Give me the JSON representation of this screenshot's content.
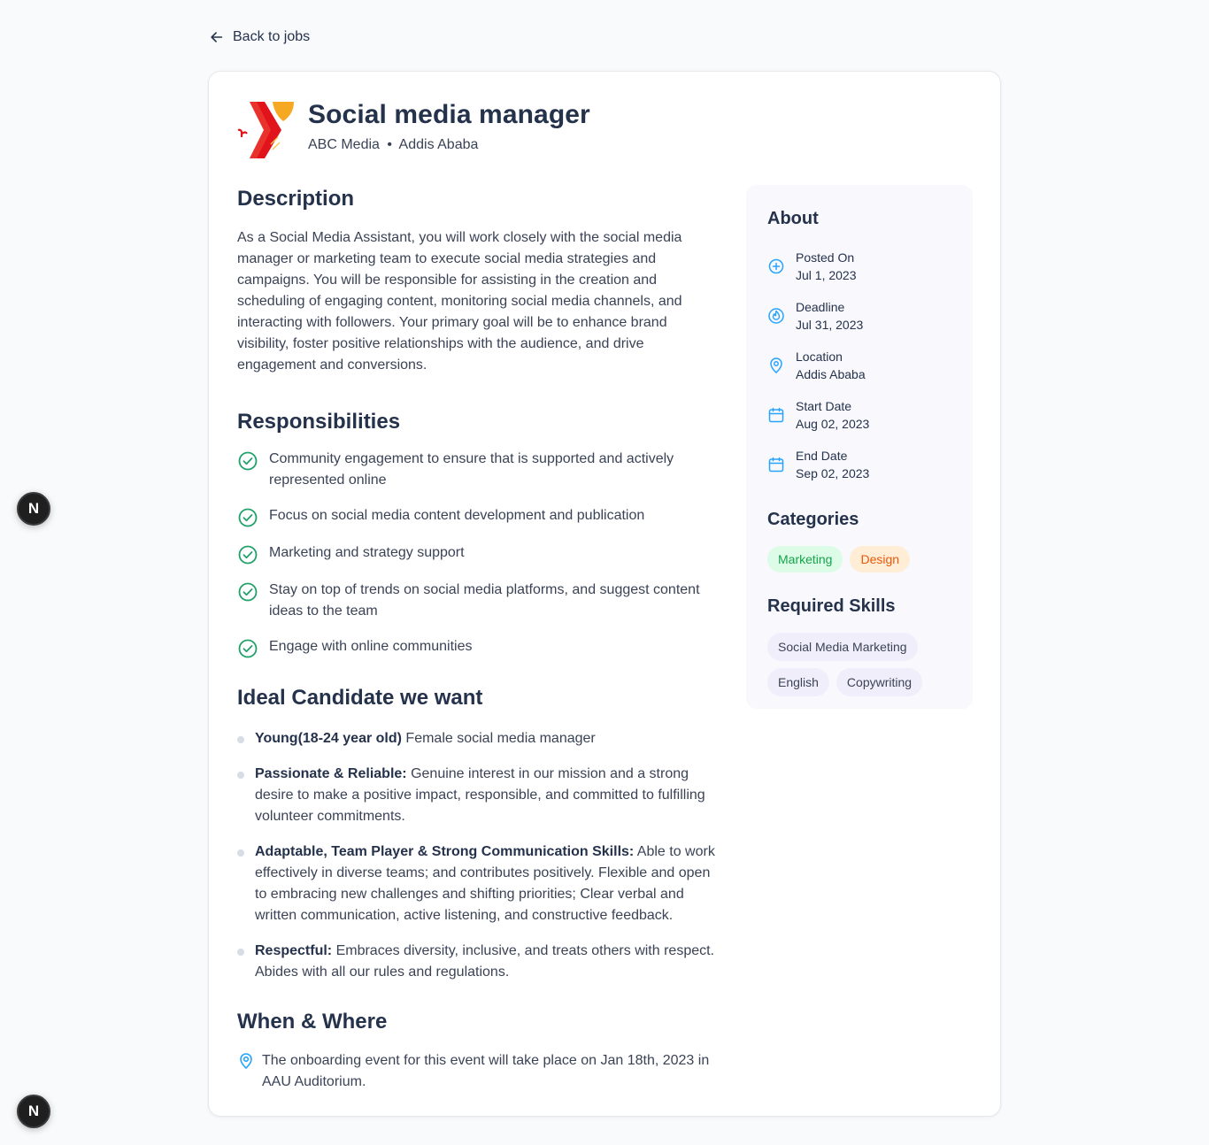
{
  "nav": {
    "back_label": "Back to jobs"
  },
  "job": {
    "title": "Social media manager",
    "company": "ABC Media",
    "separator": "•",
    "location": "Addis Ababa"
  },
  "description": {
    "heading": "Description",
    "text": "As a Social Media Assistant, you will work closely with the social media manager or marketing team to execute social media strategies and campaigns. You will be responsible for assisting in the creation and scheduling of engaging content, monitoring social media channels, and interacting with followers. Your primary goal will be to enhance brand visibility, foster positive relationships with the audience, and drive engagement and conversions."
  },
  "responsibilities": {
    "heading": "Responsibilities",
    "items": [
      "Community engagement to ensure that is supported and actively represented online",
      "Focus on social media content development and publication",
      "Marketing and strategy support",
      "Stay on top of trends on social media platforms, and suggest content ideas to the team",
      "Engage with online communities"
    ]
  },
  "ideal": {
    "heading": "Ideal Candidate we want",
    "items": [
      {
        "bold": "Young(18-24 year old)",
        "text": " Female social media manager"
      },
      {
        "bold": "Passionate & Reliable:",
        "text": " Genuine interest in our mission and a strong desire to make a positive impact, responsible, and committed to fulfilling volunteer commitments."
      },
      {
        "bold": "Adaptable, Team Player & Strong Communication Skills:",
        "text": " Able to work effectively in diverse teams; and contributes positively. Flexible and open to embracing new challenges and shifting priorities; Clear verbal and written communication, active listening, and constructive feedback."
      },
      {
        "bold": "Respectful:",
        "text": " Embraces diversity, inclusive, and treats others with respect. Abides with all our rules and regulations."
      }
    ]
  },
  "when_where": {
    "heading": "When & Where",
    "text": "The onboarding event for this event will take place on Jan 18th, 2023 in AAU Auditorium."
  },
  "about": {
    "heading": "About",
    "items": [
      {
        "label": "Posted On",
        "value": "Jul 1, 2023",
        "icon": "plus-circle-icon"
      },
      {
        "label": "Deadline",
        "value": "Jul 31, 2023",
        "icon": "fire-icon"
      },
      {
        "label": "Location",
        "value": "Addis Ababa",
        "icon": "location-pin-icon"
      },
      {
        "label": "Start Date",
        "value": "Aug 02, 2023",
        "icon": "calendar-icon"
      },
      {
        "label": "End Date",
        "value": "Sep 02, 2023",
        "icon": "calendar-icon"
      }
    ]
  },
  "categories": {
    "heading": "Categories",
    "items": [
      "Marketing",
      "Design"
    ]
  },
  "skills": {
    "heading": "Required Skills",
    "items": [
      "Social Media Marketing",
      "English",
      "Copywriting"
    ]
  },
  "fab": {
    "label": "N"
  },
  "colors": {
    "accent_blue": "#26a4ff",
    "check_green": "#56cdad",
    "text_dark": "#25324b"
  }
}
